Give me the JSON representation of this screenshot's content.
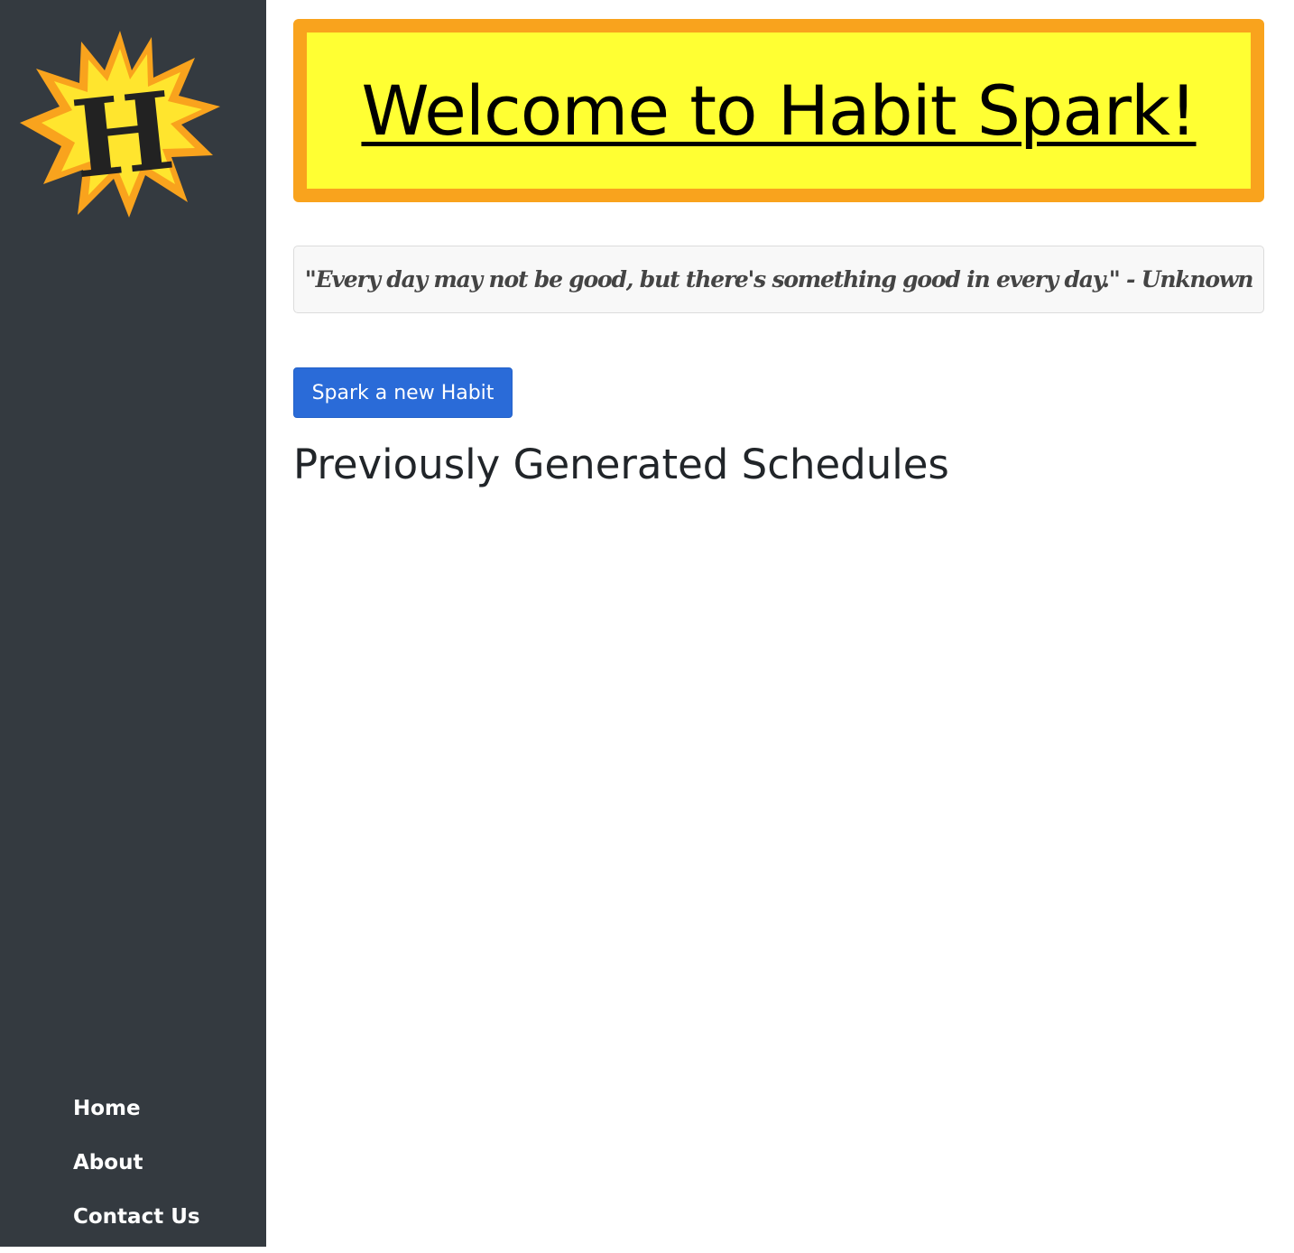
{
  "logo": {
    "letter": "H",
    "colors": {
      "outer": "#f9a31d",
      "inner": "#ffe52e",
      "letter": "#222222"
    }
  },
  "sidebar": {
    "nav": [
      {
        "label": "Home"
      },
      {
        "label": "About"
      },
      {
        "label": "Contact Us"
      }
    ]
  },
  "banner": {
    "title": "Welcome to Habit Spark!"
  },
  "quote": {
    "text": "\"Every day may not be good, but there's something good in every day.\" - Unknown"
  },
  "actions": {
    "spark_button_label": "Spark a new Habit"
  },
  "schedules": {
    "heading": "Previously Generated Schedules"
  },
  "colors": {
    "sidebar_bg": "#343a40",
    "banner_bg": "#ffff33",
    "banner_border": "#f9a31d",
    "button_primary": "#2a6bd8"
  }
}
